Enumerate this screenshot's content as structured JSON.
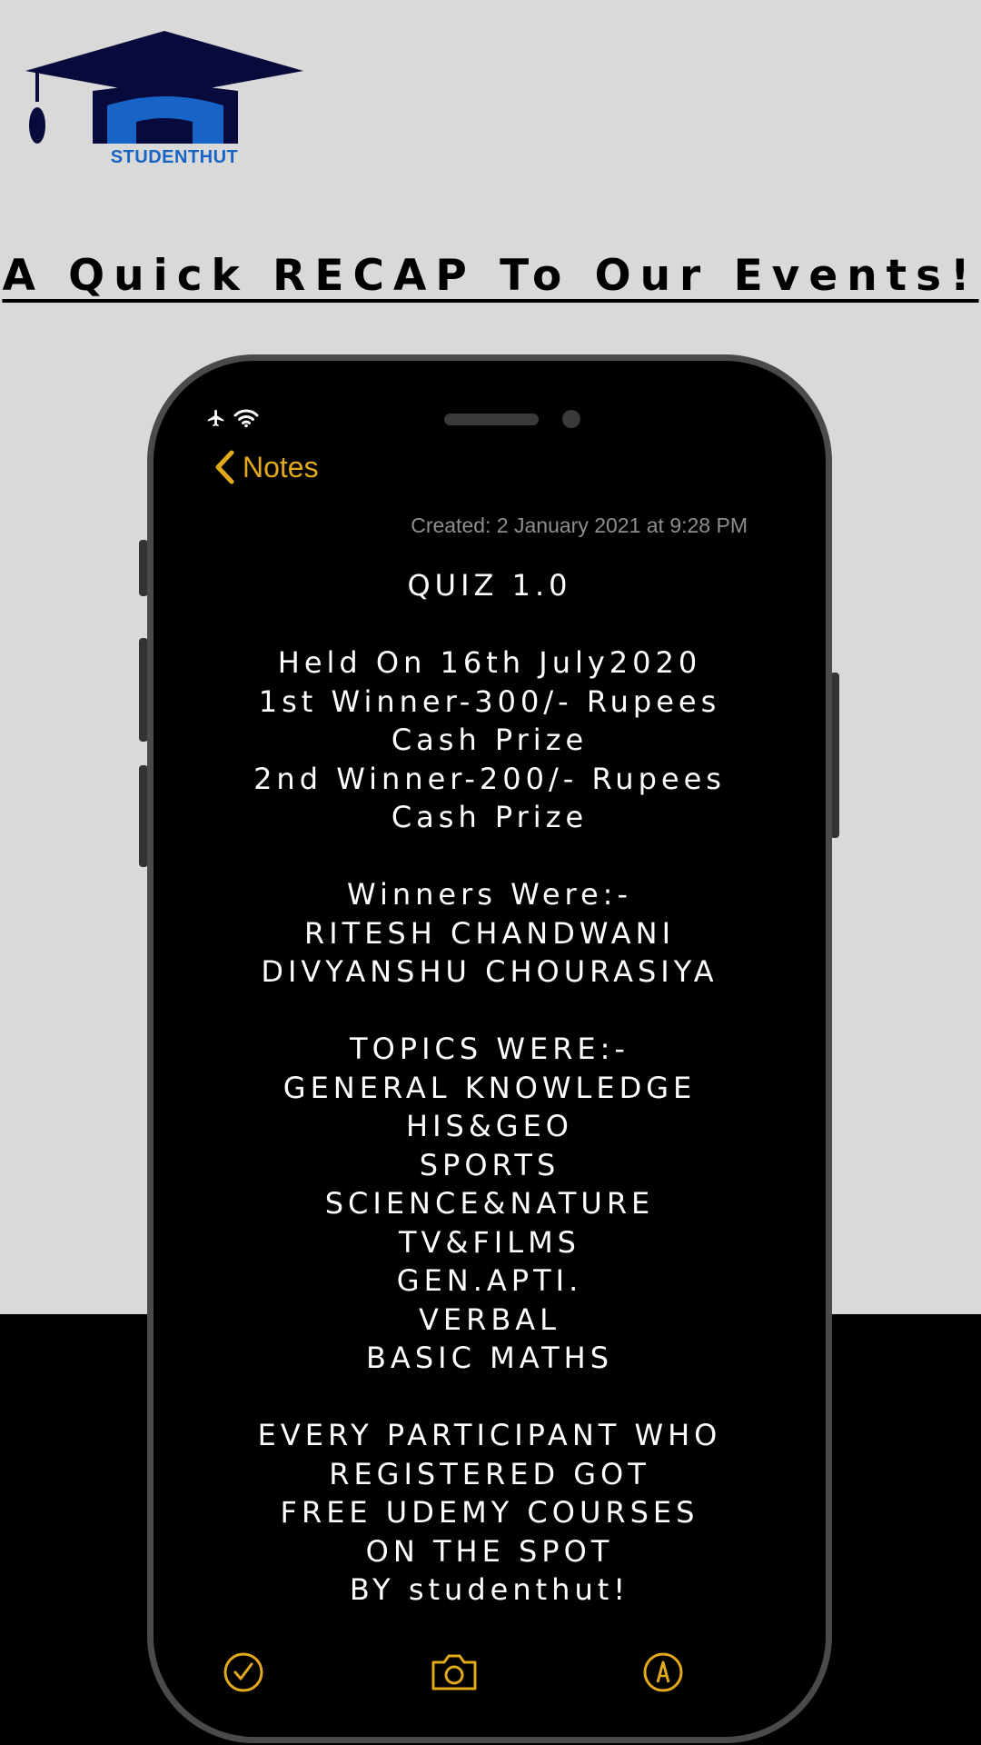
{
  "brand": {
    "logo_text": "STUDENTHUT",
    "navy": "#070a3a",
    "blue": "#1763c6"
  },
  "headline": "A Quick RECAP To Our Events!",
  "notes_app": {
    "back_label": "Notes",
    "created": "Created: 2 January 2021 at 9:28 PM",
    "accent_color": "#e2a91d",
    "status_icons": [
      "airplane-icon",
      "wifi-icon"
    ],
    "toolbar_icons": [
      "checklist-icon",
      "camera-icon",
      "markup-pen-icon"
    ]
  },
  "note": {
    "title": "QUIZ 1.0",
    "held_on": "Held On 16th July2020",
    "prizes": [
      "1st Winner-300/- Rupees",
      "Cash Prize",
      "2nd Winner-200/- Rupees",
      "Cash Prize"
    ],
    "winners_heading": "Winners Were:-",
    "winners": [
      "RITESH CHANDWANI",
      "DIVYANSHU CHOURASIYA"
    ],
    "topics_heading": "TOPICS WERE:-",
    "topics": [
      "GENERAL KNOWLEDGE",
      "HIS&GEO",
      "SPORTS",
      "SCIENCE&NATURE",
      "TV&FILMS",
      "GEN.APTI.",
      "VERBAL",
      "BASIC MATHS"
    ],
    "footer": [
      "EVERY PARTICIPANT WHO",
      "REGISTERED GOT",
      "FREE UDEMY COURSES",
      "ON THE SPOT",
      "BY studenthut!"
    ]
  }
}
